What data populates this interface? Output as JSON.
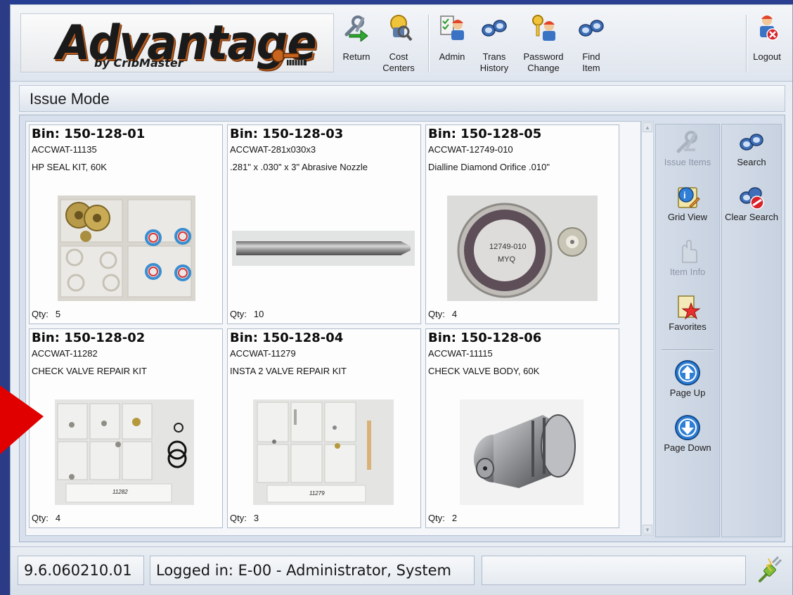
{
  "brand": {
    "logo_text": "Advantage",
    "logo_sub": "by CribMaster"
  },
  "toolbar": {
    "return_label": "Return",
    "cost_centers_label": "Cost\nCenters",
    "admin_label": "Admin",
    "trans_history_label": "Trans\nHistory",
    "password_change_label": "Password\nChange",
    "find_item_label": "Find\nItem",
    "logout_label": "Logout"
  },
  "mode": {
    "title": "Issue Mode"
  },
  "items": [
    {
      "bin": "Bin: 150-128-01",
      "part": "ACCWAT-11135",
      "description": "HP SEAL KIT, 60K",
      "qty_label": "Qty:",
      "qty": "5"
    },
    {
      "bin": "Bin: 150-128-03",
      "part": "ACCWAT-281x030x3",
      "description": ".281\" x .030\" x 3\" Abrasive Nozzle",
      "qty_label": "Qty:",
      "qty": "10"
    },
    {
      "bin": "Bin: 150-128-05",
      "part": "ACCWAT-12749-010",
      "description": "Dialline Diamond Orifice .010\"",
      "qty_label": "Qty:",
      "qty": "4",
      "photo_text": "12749-010\nMYQ"
    },
    {
      "bin": "Bin: 150-128-02",
      "part": "ACCWAT-11282",
      "description": "CHECK VALVE REPAIR KIT",
      "qty_label": "Qty:",
      "qty": "4",
      "photo_text": "11282"
    },
    {
      "bin": "Bin: 150-128-04",
      "part": "ACCWAT-11279",
      "description": "INSTA 2 VALVE REPAIR KIT",
      "qty_label": "Qty:",
      "qty": "3",
      "photo_text": "11279"
    },
    {
      "bin": "Bin: 150-128-06",
      "part": "ACCWAT-11115",
      "description": "CHECK VALVE BODY, 60K",
      "qty_label": "Qty:",
      "qty": "2"
    }
  ],
  "side_actions": {
    "issue_items": "Issue Items",
    "grid_view": "Grid View",
    "item_info": "Item Info",
    "favorites": "Favorites",
    "page_up": "Page Up",
    "page_down": "Page Down",
    "search": "Search",
    "clear_search": "Clear Search"
  },
  "status": {
    "version": "9.6.060210.01",
    "logged_in": "Logged in: E-00 - Administrator, System",
    "message": ""
  },
  "colors": {
    "accent_blue": "#2f7fd6",
    "backdrop_blue": "#2a3f8f",
    "annotation_red": "#e00000"
  }
}
